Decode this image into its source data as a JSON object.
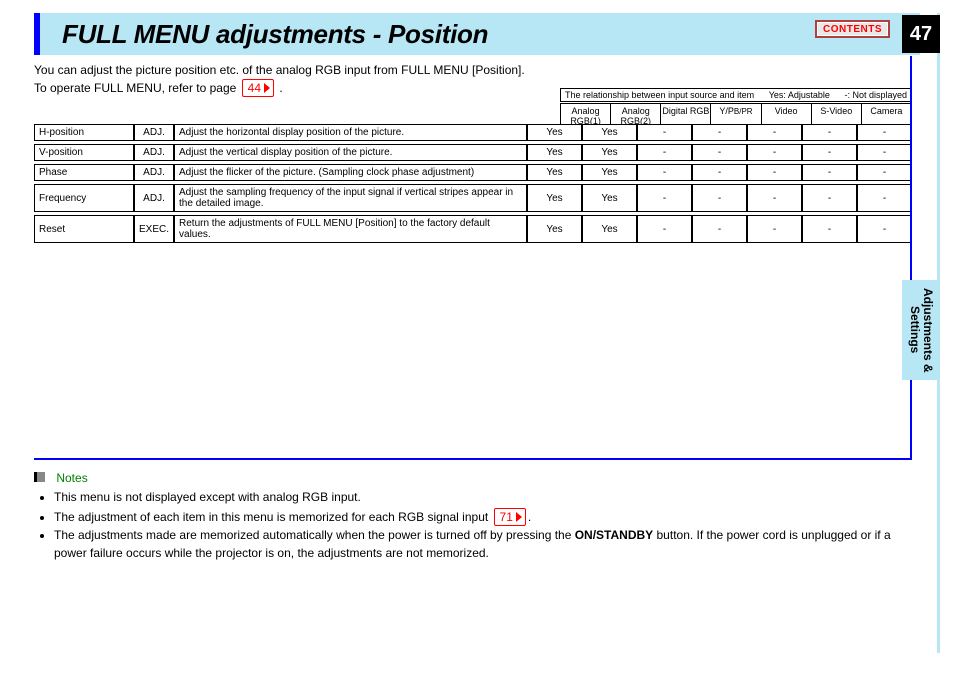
{
  "page_number": "47",
  "contents_label": "CONTENTS",
  "title": "FULL MENU adjustments - Position",
  "side_tab": "Adjustments & Settings",
  "intro": {
    "line1": "You can adjust the picture position etc. of the analog RGB input from FULL MENU [Position].",
    "line2_a": "To operate FULL MENU, refer to page ",
    "ref44": "44",
    "line2_b": "."
  },
  "rel_caption": {
    "left": "The relationship between input source and item",
    "mid": "Yes: Adjustable",
    "right": "-: Not displayed"
  },
  "source_columns": [
    "Analog RGB(1)",
    "Analog RGB(2)",
    "Digital RGB",
    "Y/P",
    "Video",
    "S-Video",
    "Camera"
  ],
  "ypbpr_sub": "B/PR",
  "rows": [
    {
      "name": "H-position",
      "type": "ADJ.",
      "desc": "Adjust the horizontal display position of the picture.",
      "src": [
        "Yes",
        "Yes",
        "-",
        "-",
        "-",
        "-",
        "-"
      ]
    },
    {
      "name": "V-position",
      "type": "ADJ.",
      "desc": "Adjust the vertical display position of the picture.",
      "src": [
        "Yes",
        "Yes",
        "-",
        "-",
        "-",
        "-",
        "-"
      ]
    },
    {
      "name": "Phase",
      "type": "ADJ.",
      "desc": "Adjust the flicker of the picture. (Sampling clock phase adjustment)",
      "src": [
        "Yes",
        "Yes",
        "-",
        "-",
        "-",
        "-",
        "-"
      ]
    },
    {
      "name": "Frequency",
      "type": "ADJ.",
      "desc": "Adjust the sampling frequency of the input signal if vertical stripes appear in the detailed image.",
      "src": [
        "Yes",
        "Yes",
        "-",
        "-",
        "-",
        "-",
        "-"
      ]
    },
    {
      "name": "Reset",
      "type": "EXEC.",
      "desc": "Return the adjustments of FULL MENU [Position] to the factory default values.",
      "src": [
        "Yes",
        "Yes",
        "-",
        "-",
        "-",
        "-",
        "-"
      ]
    }
  ],
  "notes": {
    "title": "Notes",
    "items": [
      {
        "text_a": "This menu is not displayed except with analog RGB input."
      },
      {
        "text_a": "The adjustment of each item in this menu is memorized for each RGB signal input ",
        "ref": "71",
        "text_b": "."
      },
      {
        "text_a": "The adjustments made are memorized automatically when the power is turned off by pressing the ",
        "bold": "ON/STANDBY",
        "text_b": " button. If the power cord is unplugged or if a power failure occurs while the projector is on, the adjustments are not memorized."
      }
    ]
  }
}
